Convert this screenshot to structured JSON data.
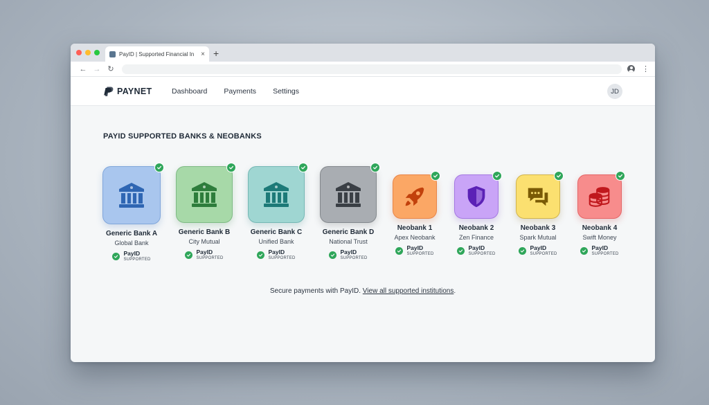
{
  "browser": {
    "tab_title": "PayID | Supported Financial In",
    "tab_close": "×",
    "new_tab": "+",
    "back": "←",
    "forward": "→",
    "reload": "↻",
    "menu": "⋮"
  },
  "header": {
    "brand": "PAYNET",
    "nav": [
      "Dashboard",
      "Payments",
      "Settings"
    ],
    "avatar_initials": "JD"
  },
  "main": {
    "title": "PAYID SUPPORTED BANKS & NEOBANKS",
    "institutions": [
      {
        "name": "Generic Bank A",
        "subtitle": "Global Bank",
        "status": "PayID",
        "status_sub": "SUPPORTED",
        "icon": "bank-icon",
        "color": "#2f66b3",
        "bg": "#a9c6ee"
      },
      {
        "name": "Generic Bank B",
        "subtitle": "City Mutual",
        "status": "PayID",
        "status_sub": "SUPPORTED",
        "icon": "bank-icon",
        "color": "#2e7d3c",
        "bg": "#a7d9a8"
      },
      {
        "name": "Generic Bank C",
        "subtitle": "Unified Bank",
        "status": "PayID",
        "status_sub": "SUPPORTED",
        "icon": "bank-icon",
        "color": "#1d7a78",
        "bg": "#9fd6d2"
      },
      {
        "name": "Generic Bank D",
        "subtitle": "National Trust",
        "status": "PayID",
        "status_sub": "SUPPORTED",
        "icon": "bank-icon",
        "color": "#3a3f45",
        "bg": "#a9adb2"
      },
      {
        "name": "Neobank 1",
        "subtitle": "Apex Neobank",
        "status": "PayID",
        "status_sub": "SUPPORTED",
        "icon": "rocket-icon",
        "color": "#c2410c",
        "bg": "#fba765"
      },
      {
        "name": "Neobank 2",
        "subtitle": "Zen Finance",
        "status": "PayID",
        "status_sub": "SUPPORTED",
        "icon": "shield-icon",
        "color": "#5b21b6",
        "bg": "#c9a4f7"
      },
      {
        "name": "Neobank 3",
        "subtitle": "Spark Mutual",
        "status": "PayID",
        "status_sub": "SUPPORTED",
        "icon": "chat-icon",
        "color": "#7a5a05",
        "bg": "#fbe070"
      },
      {
        "name": "Neobank 4",
        "subtitle": "Swift Money",
        "status": "PayID",
        "status_sub": "SUPPORTED",
        "icon": "coins-icon",
        "color": "#c0181d",
        "bg": "#f78c8c"
      }
    ]
  },
  "footer": {
    "text": "Secure payments with PayID.",
    "link": "View all supported institutions",
    "end": "."
  },
  "colors": {
    "success": "#2fa65a",
    "traffic_red": "#ff5f57",
    "traffic_yellow": "#febc2e",
    "traffic_green": "#28c840"
  }
}
